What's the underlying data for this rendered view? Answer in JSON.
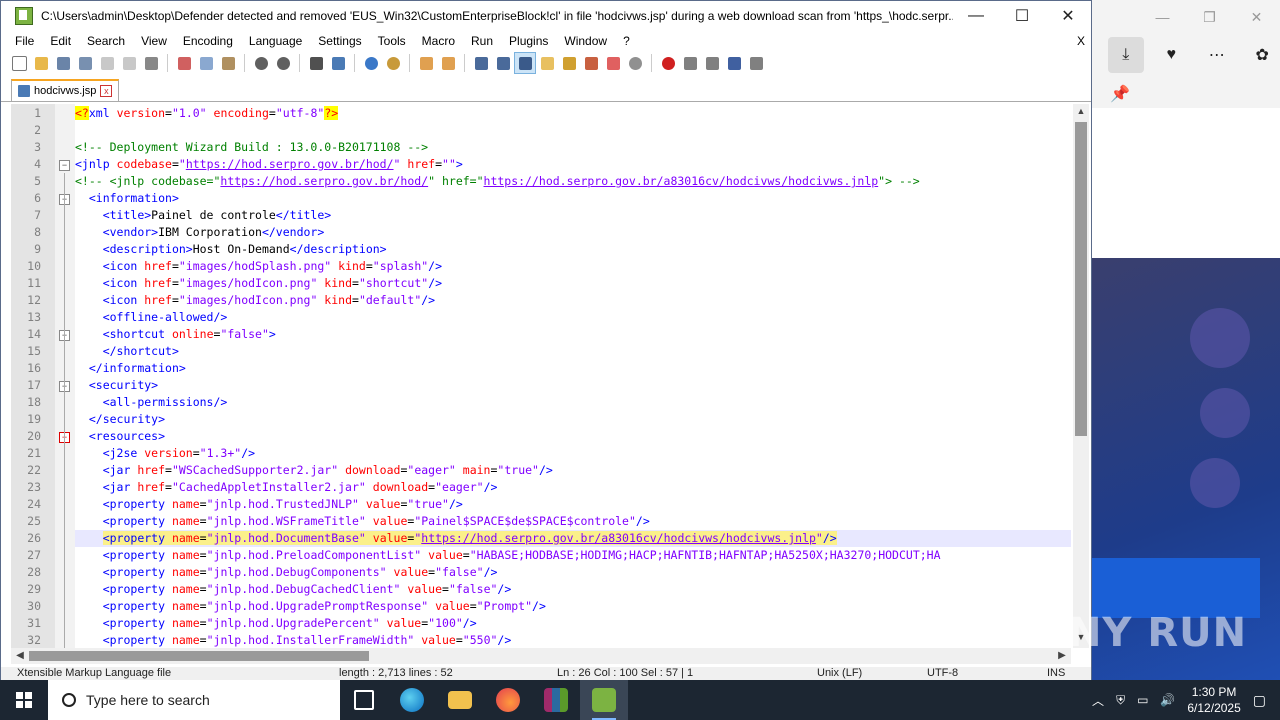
{
  "window": {
    "title": "C:\\Users\\admin\\Desktop\\Defender detected and removed 'EUS_Win32\\CustomEnterpriseBlock!cl' in file 'hodcivws.jsp' during a web download scan from 'https_\\hodc.serpr...",
    "minimize": "—",
    "maximize": "☐",
    "close": "✕"
  },
  "menu": [
    "File",
    "Edit",
    "Search",
    "View",
    "Encoding",
    "Language",
    "Settings",
    "Tools",
    "Macro",
    "Run",
    "Plugins",
    "Window",
    "?"
  ],
  "menu_close": "X",
  "tab": {
    "label": "hodcivws.jsp",
    "close": "x"
  },
  "code_lines": [
    [
      [
        "decl",
        "<?"
      ],
      [
        "tag",
        "xml "
      ],
      [
        "attr",
        "version"
      ],
      [
        "text",
        "="
      ],
      [
        "val",
        "\"1.0\" "
      ],
      [
        "attr",
        "encoding"
      ],
      [
        "text",
        "="
      ],
      [
        "val",
        "\"utf-8\""
      ],
      [
        "decl",
        "?>"
      ]
    ],
    [],
    [
      [
        "com",
        "<!-- Deployment Wizard Build : 13.0.0-B20171108 -->"
      ]
    ],
    [
      [
        "tag",
        "<jnlp "
      ],
      [
        "attr",
        "codebase"
      ],
      [
        "text",
        "="
      ],
      [
        "val",
        "\""
      ],
      [
        "url",
        "https://hod.serpro.gov.br/hod/"
      ],
      [
        "val",
        "\" "
      ],
      [
        "attr",
        "href"
      ],
      [
        "text",
        "="
      ],
      [
        "val",
        "\"\""
      ],
      [
        "tag",
        ">"
      ]
    ],
    [
      [
        "com",
        "<!-- <jnlp codebase=\""
      ],
      [
        "url",
        "https://hod.serpro.gov.br/hod/"
      ],
      [
        "com",
        "\" href=\""
      ],
      [
        "url",
        "https://hod.serpro.gov.br/a83016cv/hodcivws/hodcivws.jnlp"
      ],
      [
        "com",
        "\"> -->"
      ]
    ],
    [
      [
        "text",
        "  "
      ],
      [
        "tag",
        "<information>"
      ]
    ],
    [
      [
        "text",
        "    "
      ],
      [
        "tag",
        "<title>"
      ],
      [
        "text",
        "Painel de controle"
      ],
      [
        "tag",
        "</title>"
      ]
    ],
    [
      [
        "text",
        "    "
      ],
      [
        "tag",
        "<vendor>"
      ],
      [
        "text",
        "IBM Corporation"
      ],
      [
        "tag",
        "</vendor>"
      ]
    ],
    [
      [
        "text",
        "    "
      ],
      [
        "tag",
        "<description>"
      ],
      [
        "text",
        "Host On-Demand"
      ],
      [
        "tag",
        "</description>"
      ]
    ],
    [
      [
        "text",
        "    "
      ],
      [
        "tag",
        "<icon "
      ],
      [
        "attr",
        "href"
      ],
      [
        "text",
        "="
      ],
      [
        "val",
        "\"images/hodSplash.png\" "
      ],
      [
        "attr",
        "kind"
      ],
      [
        "text",
        "="
      ],
      [
        "val",
        "\"splash\""
      ],
      [
        "tag",
        "/>"
      ]
    ],
    [
      [
        "text",
        "    "
      ],
      [
        "tag",
        "<icon "
      ],
      [
        "attr",
        "href"
      ],
      [
        "text",
        "="
      ],
      [
        "val",
        "\"images/hodIcon.png\" "
      ],
      [
        "attr",
        "kind"
      ],
      [
        "text",
        "="
      ],
      [
        "val",
        "\"shortcut\""
      ],
      [
        "tag",
        "/>"
      ]
    ],
    [
      [
        "text",
        "    "
      ],
      [
        "tag",
        "<icon "
      ],
      [
        "attr",
        "href"
      ],
      [
        "text",
        "="
      ],
      [
        "val",
        "\"images/hodIcon.png\" "
      ],
      [
        "attr",
        "kind"
      ],
      [
        "text",
        "="
      ],
      [
        "val",
        "\"default\""
      ],
      [
        "tag",
        "/>"
      ]
    ],
    [
      [
        "text",
        "    "
      ],
      [
        "tag",
        "<offline-allowed/>"
      ]
    ],
    [
      [
        "text",
        "    "
      ],
      [
        "tag",
        "<shortcut "
      ],
      [
        "attr",
        "online"
      ],
      [
        "text",
        "="
      ],
      [
        "val",
        "\"false\""
      ],
      [
        "tag",
        ">"
      ]
    ],
    [
      [
        "text",
        "    "
      ],
      [
        "tag",
        "</shortcut>"
      ]
    ],
    [
      [
        "text",
        "  "
      ],
      [
        "tag",
        "</information>"
      ]
    ],
    [
      [
        "text",
        "  "
      ],
      [
        "tag",
        "<security>"
      ]
    ],
    [
      [
        "text",
        "    "
      ],
      [
        "tag",
        "<all-permissions/>"
      ]
    ],
    [
      [
        "text",
        "  "
      ],
      [
        "tag",
        "</security>"
      ]
    ],
    [
      [
        "text",
        "  "
      ],
      [
        "tag",
        "<resources>"
      ]
    ],
    [
      [
        "text",
        "    "
      ],
      [
        "tag",
        "<j2se "
      ],
      [
        "attr",
        "version"
      ],
      [
        "text",
        "="
      ],
      [
        "val",
        "\"1.3+\""
      ],
      [
        "tag",
        "/>"
      ]
    ],
    [
      [
        "text",
        "    "
      ],
      [
        "tag",
        "<jar "
      ],
      [
        "attr",
        "href"
      ],
      [
        "text",
        "="
      ],
      [
        "val",
        "\"WSCachedSupporter2.jar\" "
      ],
      [
        "attr",
        "download"
      ],
      [
        "text",
        "="
      ],
      [
        "val",
        "\"eager\" "
      ],
      [
        "attr",
        "main"
      ],
      [
        "text",
        "="
      ],
      [
        "val",
        "\"true\""
      ],
      [
        "tag",
        "/>"
      ]
    ],
    [
      [
        "text",
        "    "
      ],
      [
        "tag",
        "<jar "
      ],
      [
        "attr",
        "href"
      ],
      [
        "text",
        "="
      ],
      [
        "val",
        "\"CachedAppletInstaller2.jar\" "
      ],
      [
        "attr",
        "download"
      ],
      [
        "text",
        "="
      ],
      [
        "val",
        "\"eager\""
      ],
      [
        "tag",
        "/>"
      ]
    ],
    [
      [
        "text",
        "    "
      ],
      [
        "tag",
        "<property "
      ],
      [
        "attr",
        "name"
      ],
      [
        "text",
        "="
      ],
      [
        "val",
        "\"jnlp.hod.TrustedJNLP\" "
      ],
      [
        "attr",
        "value"
      ],
      [
        "text",
        "="
      ],
      [
        "val",
        "\"true\""
      ],
      [
        "tag",
        "/>"
      ]
    ],
    [
      [
        "text",
        "    "
      ],
      [
        "tag",
        "<property "
      ],
      [
        "attr",
        "name"
      ],
      [
        "text",
        "="
      ],
      [
        "val",
        "\"jnlp.hod.WSFrameTitle\" "
      ],
      [
        "attr",
        "value"
      ],
      [
        "text",
        "="
      ],
      [
        "val",
        "\"Painel$SPACE$de$SPACE$controle\""
      ],
      [
        "tag",
        "/>"
      ]
    ],
    [
      [
        "text",
        "    "
      ],
      [
        "tag",
        "<property "
      ],
      [
        "attr",
        "name"
      ],
      [
        "text",
        "="
      ],
      [
        "val",
        "\"jnlp.hod.DocumentBase\" "
      ],
      [
        "attr",
        "value"
      ],
      [
        "text",
        "="
      ],
      [
        "val",
        "\""
      ],
      [
        "url",
        "https://hod.serpro.gov.br/a83016cv/hodcivws/hodcivws.jnlp"
      ],
      [
        "val",
        "\""
      ],
      [
        "tag",
        "/>"
      ]
    ],
    [
      [
        "text",
        "    "
      ],
      [
        "tag",
        "<property "
      ],
      [
        "attr",
        "name"
      ],
      [
        "text",
        "="
      ],
      [
        "val",
        "\"jnlp.hod.PreloadComponentList\" "
      ],
      [
        "attr",
        "value"
      ],
      [
        "text",
        "="
      ],
      [
        "val",
        "\"HABASE;HODBASE;HODIMG;HACP;HAFNTIB;HAFNTAP;HA5250X;HA3270;HODCUT;HA"
      ]
    ],
    [
      [
        "text",
        "    "
      ],
      [
        "tag",
        "<property "
      ],
      [
        "attr",
        "name"
      ],
      [
        "text",
        "="
      ],
      [
        "val",
        "\"jnlp.hod.DebugComponents\" "
      ],
      [
        "attr",
        "value"
      ],
      [
        "text",
        "="
      ],
      [
        "val",
        "\"false\""
      ],
      [
        "tag",
        "/>"
      ]
    ],
    [
      [
        "text",
        "    "
      ],
      [
        "tag",
        "<property "
      ],
      [
        "attr",
        "name"
      ],
      [
        "text",
        "="
      ],
      [
        "val",
        "\"jnlp.hod.DebugCachedClient\" "
      ],
      [
        "attr",
        "value"
      ],
      [
        "text",
        "="
      ],
      [
        "val",
        "\"false\""
      ],
      [
        "tag",
        "/>"
      ]
    ],
    [
      [
        "text",
        "    "
      ],
      [
        "tag",
        "<property "
      ],
      [
        "attr",
        "name"
      ],
      [
        "text",
        "="
      ],
      [
        "val",
        "\"jnlp.hod.UpgradePromptResponse\" "
      ],
      [
        "attr",
        "value"
      ],
      [
        "text",
        "="
      ],
      [
        "val",
        "\"Prompt\""
      ],
      [
        "tag",
        "/>"
      ]
    ],
    [
      [
        "text",
        "    "
      ],
      [
        "tag",
        "<property "
      ],
      [
        "attr",
        "name"
      ],
      [
        "text",
        "="
      ],
      [
        "val",
        "\"jnlp.hod.UpgradePercent\" "
      ],
      [
        "attr",
        "value"
      ],
      [
        "text",
        "="
      ],
      [
        "val",
        "\"100\""
      ],
      [
        "tag",
        "/>"
      ]
    ],
    [
      [
        "text",
        "    "
      ],
      [
        "tag",
        "<property "
      ],
      [
        "attr",
        "name"
      ],
      [
        "text",
        "="
      ],
      [
        "val",
        "\"jnlp.hod.InstallerFrameWidth\" "
      ],
      [
        "attr",
        "value"
      ],
      [
        "text",
        "="
      ],
      [
        "val",
        "\"550\""
      ],
      [
        "tag",
        "/>"
      ]
    ]
  ],
  "current_line": 26,
  "status": {
    "type": "Xtensible Markup Language file",
    "length": "length : 2,713    lines : 52",
    "position": "Ln : 26    Col : 100    Sel : 57 | 1",
    "eol": "Unix (LF)",
    "encoding": "UTF-8",
    "mode": "INS"
  },
  "watermark": "ANY RUN",
  "taskbar": {
    "search_placeholder": "Type here to search",
    "time": "1:30 PM",
    "date": "6/12/2025"
  },
  "colors": {
    "tag": "#0000ff",
    "attr": "#ff0000",
    "value": "#8000ff",
    "comment": "#008000",
    "current_line": "#e8e8ff"
  }
}
